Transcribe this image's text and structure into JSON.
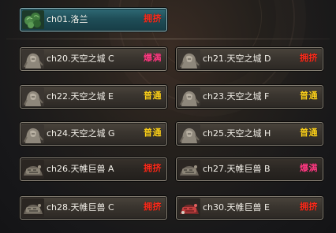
{
  "channels": [
    {
      "id": "ch01",
      "name": "ch01.洛兰",
      "status": "拥挤",
      "status_color": "#ff2a1a",
      "icon": "leaf-icon"
    },
    {
      "id": "ch20",
      "name": "ch20.天空之城 C",
      "status": "爆满",
      "status_color": "#ff3a82",
      "icon": "statue-icon"
    },
    {
      "id": "ch21",
      "name": "ch21.天空之城 D",
      "status": "拥挤",
      "status_color": "#ff2a1a",
      "icon": "statue-icon"
    },
    {
      "id": "ch22",
      "name": "ch22.天空之城 E",
      "status": "普通",
      "status_color": "#ffd21a",
      "icon": "statue-icon"
    },
    {
      "id": "ch23",
      "name": "ch23.天空之城 F",
      "status": "普通",
      "status_color": "#ffd21a",
      "icon": "statue-icon"
    },
    {
      "id": "ch24",
      "name": "ch24.天空之城 G",
      "status": "普通",
      "status_color": "#ffd21a",
      "icon": "statue-icon"
    },
    {
      "id": "ch25",
      "name": "ch25.天空之城 H",
      "status": "普通",
      "status_color": "#ffd21a",
      "icon": "statue-icon"
    },
    {
      "id": "ch26",
      "name": "ch26.天帷巨兽 A",
      "status": "拥挤",
      "status_color": "#ff2a1a",
      "icon": "beast-icon"
    },
    {
      "id": "ch27",
      "name": "ch27.天帷巨兽 B",
      "status": "爆满",
      "status_color": "#ff3a82",
      "icon": "beast-icon"
    },
    {
      "id": "ch28",
      "name": "ch28.天帷巨兽 C",
      "status": "拥挤",
      "status_color": "#ff2a1a",
      "icon": "beast-icon"
    },
    {
      "id": "ch30",
      "name": "ch30.天帷巨兽 E",
      "status": "拥挤",
      "status_color": "#ff2a1a",
      "icon": "beast-red-icon"
    }
  ]
}
